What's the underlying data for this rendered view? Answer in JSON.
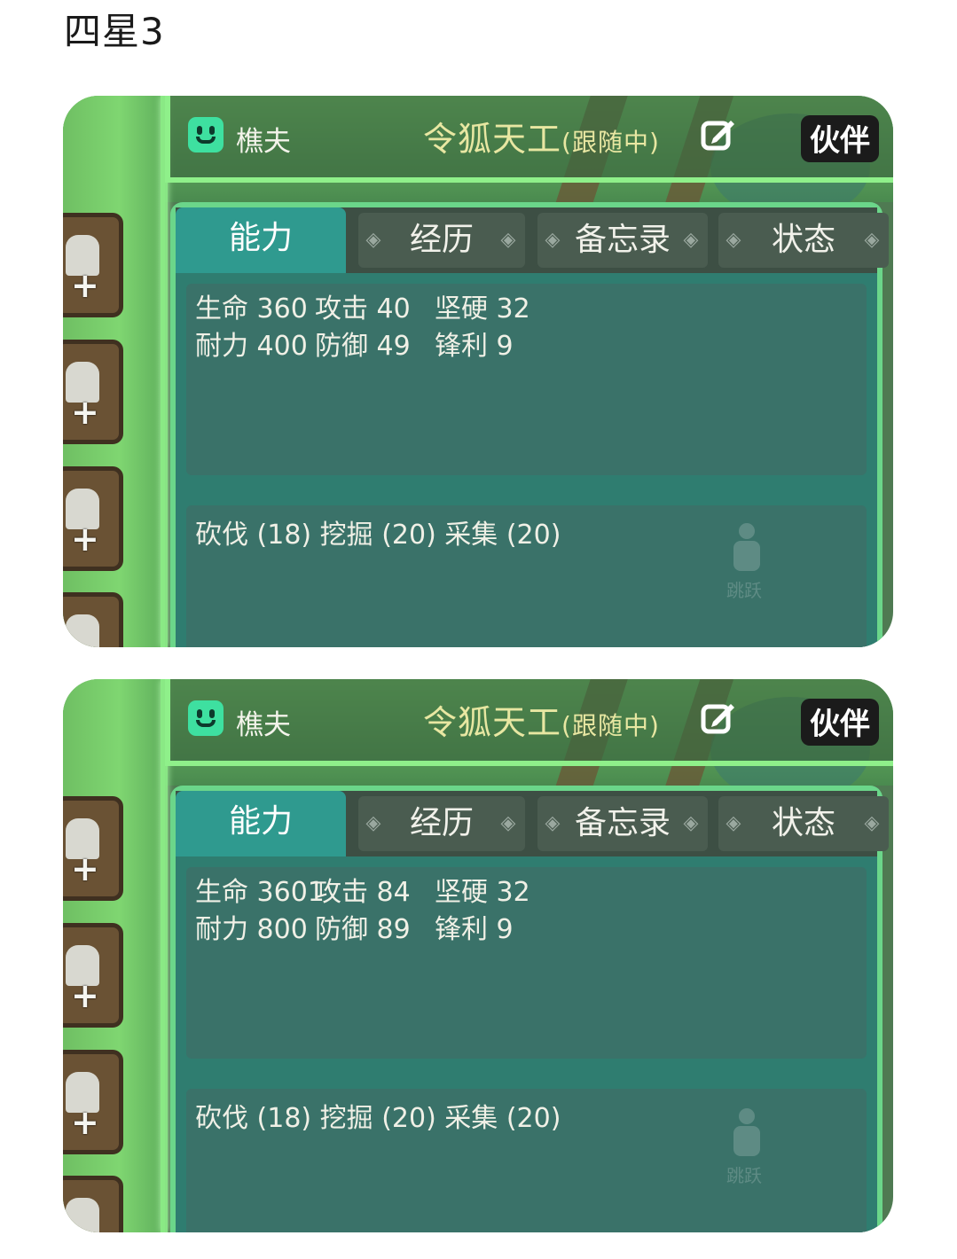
{
  "heading": "四星3",
  "cards": [
    {
      "npc_name": "樵夫",
      "title": "令狐天工",
      "title_status": "(跟随中)",
      "partner_label": "伙伴",
      "tabs": [
        "能力",
        "经历",
        "备忘录",
        "状态"
      ],
      "active_tab": "能力",
      "stats": [
        [
          {
            "label": "生命",
            "value": "360"
          },
          {
            "label": "攻击",
            "value": "40"
          },
          {
            "label": "坚硬",
            "value": "32"
          }
        ],
        [
          {
            "label": "耐力",
            "value": "400"
          },
          {
            "label": "防御",
            "value": "49"
          },
          {
            "label": "锋利",
            "value": "9"
          }
        ]
      ],
      "skills": "砍伐 (18)  挖掘 (20)  采集 (20)",
      "watermark": "跳跃"
    },
    {
      "npc_name": "樵夫",
      "title": "令狐天工",
      "title_status": "(跟随中)",
      "partner_label": "伙伴",
      "tabs": [
        "能力",
        "经历",
        "备忘录",
        "状态"
      ],
      "active_tab": "能力",
      "stats": [
        [
          {
            "label": "生命",
            "value": "3601"
          },
          {
            "label": "攻击",
            "value": "84"
          },
          {
            "label": "坚硬",
            "value": "32"
          }
        ],
        [
          {
            "label": "耐力",
            "value": "800"
          },
          {
            "label": "防御",
            "value": "89"
          },
          {
            "label": "锋利",
            "value": "9"
          }
        ]
      ],
      "skills": "砍伐 (18)  挖掘 (20)  采集 (20)",
      "watermark": "跳跃"
    }
  ],
  "colors": {
    "panel": "#2f7d70",
    "active_tab": "#2f9a8f",
    "title_text": "#e8e7a2",
    "npc_icon": "#3ee0a0",
    "glow_border": "#8ff08a"
  },
  "icons": {
    "npc": "smile-face-icon",
    "edit": "edit-pencil-icon",
    "slot": "plus-icon"
  }
}
